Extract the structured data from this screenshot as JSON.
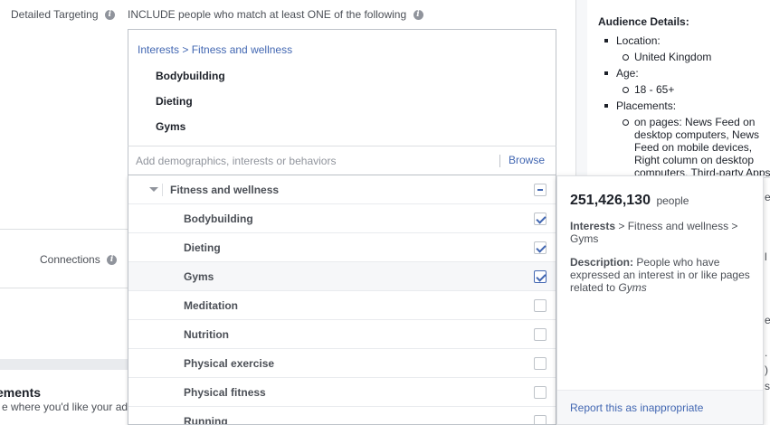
{
  "targeting": {
    "label": "Detailed Targeting",
    "include_text": "INCLUDE people who match at least ONE of the following",
    "path": "Interests > Fitness and wellness",
    "selected": [
      "Bodybuilding",
      "Dieting",
      "Gyms"
    ],
    "input_placeholder": "Add demographics, interests or behaviors",
    "browse_label": "Browse"
  },
  "connections": {
    "label": "Connections"
  },
  "placements": {
    "heading": "ements",
    "subtext": "e where you'd like your ads"
  },
  "dropdown": {
    "category": {
      "name": "Fitness and wellness",
      "state": "partial"
    },
    "items": [
      {
        "name": "Bodybuilding",
        "checked": true
      },
      {
        "name": "Dieting",
        "checked": true
      },
      {
        "name": "Gyms",
        "checked": true,
        "active": true
      },
      {
        "name": "Meditation",
        "checked": false
      },
      {
        "name": "Nutrition",
        "checked": false
      },
      {
        "name": "Physical exercise",
        "checked": false
      },
      {
        "name": "Physical fitness",
        "checked": false
      },
      {
        "name": "Running",
        "checked": false
      }
    ]
  },
  "popover": {
    "count": "251,426,130",
    "count_unit": "people",
    "interests_label": "Interests",
    "interests_path": " > Fitness and wellness > Gyms",
    "description_label": "Description:",
    "description_text": " People who have expressed an interest in or like pages related to ",
    "description_topic": "Gyms",
    "report_label": "Report this as inappropriate"
  },
  "audience": {
    "title": "Audience Details:",
    "location_label": "Location:",
    "location_value": "United Kingdom",
    "age_label": "Age:",
    "age_value": "18 - 65+",
    "placements_label": "Placements:",
    "placements_value": "on pages: News Feed on desktop computers, News Feed on mobile devices, Right column on desktop computers, Third-party Apps and Websites on mobile devices or Instagram Feed"
  },
  "icons": {
    "info": "info-icon",
    "caret": "caret-down-icon",
    "check": "checkbox-icon"
  },
  "colors": {
    "link": "#4267b2",
    "text": "#1d2129",
    "muted": "#90949c",
    "border": "#bec3c9",
    "panel": "#f6f7f9"
  }
}
